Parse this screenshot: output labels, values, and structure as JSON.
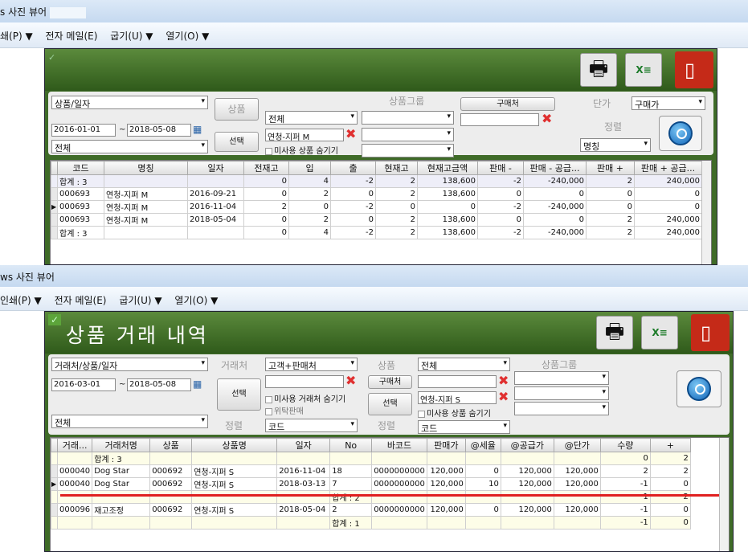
{
  "top": {
    "titlebar": "s 사진 뷰어",
    "menu": [
      "쇄(P) ▼",
      "전자 메일(E)",
      "굽기(U) ▼",
      "열기(O) ▼"
    ],
    "filters": {
      "type": "상품/일자",
      "date_from": "2016-01-01",
      "date_to": "2018-05-08",
      "scope": "전체",
      "product_label": "상품",
      "product_value": "전체",
      "select_btn": "선택",
      "product_text": "연청-지퍼 M",
      "hide_unused": "미사용 상품 숨기기",
      "group_label": "상품그룹",
      "buyer_btn": "구매처",
      "price_label": "단가",
      "price_value": "구매가",
      "sort_label": "정렬",
      "sort_value": "명칭"
    },
    "columns": [
      "코드",
      "명칭",
      "일자",
      "전재고",
      "입",
      "출",
      "현재고",
      "현재고금액",
      "판매 -",
      "판매 - 공급...",
      "판매 +",
      "판매 + 공급..."
    ],
    "rows": [
      [
        "합계 : 3",
        "",
        "",
        "0",
        "4",
        "-2",
        "2",
        "138,600",
        "-2",
        "-240,000",
        "2",
        "240,000"
      ],
      [
        "000693",
        "연청-지퍼 M",
        "2016-09-21",
        "0",
        "2",
        "0",
        "2",
        "138,600",
        "0",
        "0",
        "0",
        "0"
      ],
      [
        "000693",
        "연청-지퍼 M",
        "2016-11-04",
        "2",
        "0",
        "-2",
        "0",
        "0",
        "-2",
        "-240,000",
        "0",
        "0"
      ],
      [
        "000693",
        "연청-지퍼 M",
        "2018-05-04",
        "0",
        "2",
        "0",
        "2",
        "138,600",
        "0",
        "0",
        "2",
        "240,000"
      ],
      [
        "합계 : 3",
        "",
        "",
        "0",
        "4",
        "-2",
        "2",
        "138,600",
        "-2",
        "-240,000",
        "2",
        "240,000"
      ]
    ]
  },
  "bottom": {
    "titlebar": "ws 사진 뷰어",
    "menu": [
      "인쇄(P) ▼",
      "전자 메일(E)",
      "굽기(U) ▼",
      "열기(O) ▼"
    ],
    "title": "상품 거래 내역",
    "filters": {
      "type": "거래처/상품/일자",
      "date_from": "2016-03-01",
      "date_to": "2018-05-08",
      "scope": "전체",
      "partner_label": "거래처",
      "partner_value": "고객+판매처",
      "select_btn": "선택",
      "hide_unused_partner": "미사용 거래처 숨기기",
      "consign": "위탁판매",
      "sort_label": "정렬",
      "sort1": "코드",
      "product_label": "상품",
      "product_value": "전체",
      "buyer_btn": "구매처",
      "select_btn2": "선택",
      "product_text": "연청-지퍼 S",
      "hide_unused": "미사용 상품 숨기기",
      "sort2": "코드",
      "group_label": "상품그룹"
    },
    "columns": [
      "거래...",
      "거래처명",
      "상품",
      "상품명",
      "일자",
      "No",
      "바코드",
      "판매가",
      "@세율",
      "@공급가",
      "@단가",
      "수량",
      "+"
    ],
    "rows": [
      [
        "",
        "합계 : 3",
        "",
        "",
        "",
        "",
        "",
        "",
        "",
        "",
        "",
        "0",
        "2"
      ],
      [
        "000040",
        "Dog Star",
        "000692",
        "연청-지퍼 S",
        "2016-11-04",
        "18",
        "0000000000",
        "120,000",
        "0",
        "120,000",
        "120,000",
        "2",
        "2"
      ],
      [
        "000040",
        "Dog Star",
        "000692",
        "연청-지퍼 S",
        "2018-03-13",
        "7",
        "0000000000",
        "120,000",
        "10",
        "120,000",
        "120,000",
        "-1",
        "0"
      ],
      [
        "",
        "",
        "",
        "",
        "",
        "합계 : 2",
        "",
        "",
        "",
        "",
        "",
        "1",
        "2"
      ],
      [
        "000096",
        "재고조정",
        "000692",
        "연청-지퍼 S",
        "2018-05-04",
        "2",
        "0000000000",
        "120,000",
        "0",
        "120,000",
        "120,000",
        "-1",
        "0"
      ],
      [
        "",
        "",
        "",
        "",
        "",
        "합계 : 1",
        "",
        "",
        "",
        "",
        "",
        "-1",
        "0"
      ]
    ]
  },
  "colors": {
    "accent_green": "#3f6b28",
    "red_line": "#e02020"
  }
}
